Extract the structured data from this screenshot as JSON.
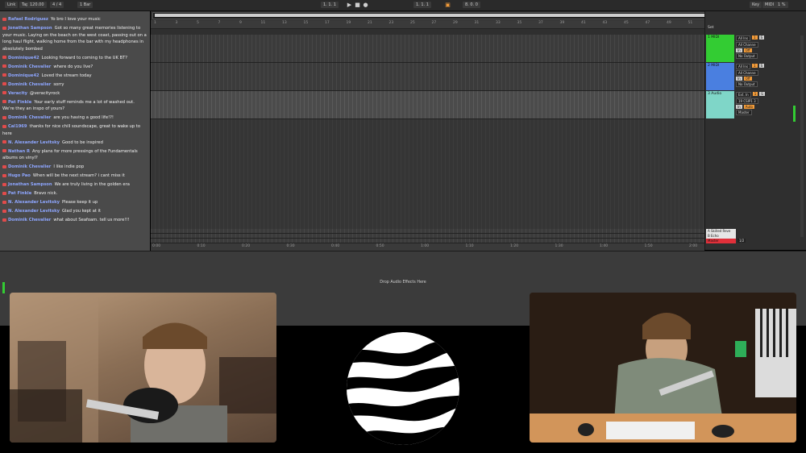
{
  "transport": {
    "link": "Link",
    "tap": "Tap",
    "bpm": "120.00",
    "sig": "4 / 4",
    "quant": "1 Bar",
    "position": "1. 1. 1",
    "loop_start": "1. 1. 1",
    "loop_len": "8. 0. 0",
    "key": "Key",
    "midi": "MIDI",
    "cpu": "1 %"
  },
  "chat": {
    "messages": [
      {
        "user": "Rafael Rodriguez",
        "text": "Yo bro I love your music",
        "color": "#8ea6ff"
      },
      {
        "user": "Jonathan Sampson",
        "text": "Got so many great memories listening to your music. Laying on the beach on the west coast, passing out on a long haul flight, walking home from the bar with my headphones in absolutely bombed",
        "color": "#8ea6ff"
      },
      {
        "user": "Dominique42",
        "text": "Looking forward to coming to the UK BT?",
        "color": "#8ea6ff"
      },
      {
        "user": "Dominik Chevalier",
        "text": "where do you live?",
        "color": "#8ea6ff"
      },
      {
        "user": "Dominique42",
        "text": "Loved the stream today",
        "color": "#8ea6ff"
      },
      {
        "user": "Dominik Chevalier",
        "text": "sorry",
        "color": "#8ea6ff"
      },
      {
        "user": "Veracity",
        "text": "@veracityrock",
        "color": "#8ea6ff"
      },
      {
        "user": "Pat Finkle",
        "text": "Your early stuff reminds me a lot of washed out. We're they an inspo of yours?",
        "color": "#8ea6ff"
      },
      {
        "user": "Dominik Chevalier",
        "text": "are you having a good life!?!",
        "color": "#8ea6ff"
      },
      {
        "user": "Cal1969",
        "text": "thanks for nice chill soundscape, great to wake up to here",
        "color": "#8ea6ff"
      },
      {
        "user": "N. Alexander Levitsky",
        "text": "Good to be inspired",
        "color": "#8ea6ff"
      },
      {
        "user": "Nathan R",
        "text": "Any plans for more pressings of the Fundamentals albums on vinyl?",
        "color": "#8ea6ff"
      },
      {
        "user": "Dominik Chevalier",
        "text": "I like indie pop",
        "color": "#8ea6ff"
      },
      {
        "user": "Hugo Pao",
        "text": "When will be the next stream? i cant miss it",
        "color": "#8ea6ff"
      },
      {
        "user": "Jonathan Sampson",
        "text": "We are truly living in the golden era",
        "color": "#8ea6ff"
      },
      {
        "user": "Pat Finkle",
        "text": "Bravo nick.",
        "color": "#8ea6ff"
      },
      {
        "user": "N. Alexander Levitsky",
        "text": "Please keep it up",
        "color": "#8ea6ff"
      },
      {
        "user": "N. Alexander Levitsky",
        "text": "Glad you kept at it",
        "color": "#8ea6ff"
      },
      {
        "user": "Dominik Chevalier",
        "text": "what about Seafoam. tell us more!!!",
        "color": "#8ea6ff"
      }
    ]
  },
  "arrangement": {
    "beats": [
      "1",
      "3",
      "5",
      "7",
      "9",
      "11",
      "13",
      "15",
      "17",
      "19",
      "21",
      "23",
      "25",
      "27",
      "29",
      "31",
      "33",
      "35",
      "37",
      "39",
      "41",
      "43",
      "45",
      "47",
      "49",
      "51"
    ],
    "times": [
      "0:00",
      "0:10",
      "0:20",
      "0:30",
      "0:40",
      "0:50",
      "1:00",
      "1:10",
      "1:20",
      "1:30",
      "1:40",
      "1:50",
      "2:00"
    ]
  },
  "tracks": [
    {
      "name": "1 MIDI",
      "color": "#33cc33",
      "in": "All Ins",
      "ch": "All Channe",
      "mon": "In",
      "auto": "Off",
      "out": "No Output"
    },
    {
      "name": "2 MIDI",
      "color": "#4a7fe0",
      "in": "All Ins",
      "ch": "All Channe",
      "mon": "In",
      "auto": "Off",
      "out": "No Output"
    },
    {
      "name": "3 Audio",
      "color": "#7fd6c8",
      "in": "Ext. In",
      "ch": "19 CSIP1 3",
      "mon": "In",
      "auto": "Auto",
      "out": "Master"
    }
  ],
  "returns": [
    {
      "name": "A Skilled Reve",
      "color": "#e6e6e6"
    },
    {
      "name": "B Echo",
      "color": "#e6e6e6"
    },
    {
      "name": "Master",
      "color": "#e0303a"
    }
  ],
  "mixer": {
    "set_label": "Set",
    "master_sel": "1/2"
  },
  "device": {
    "drop_text": "Drop Audio Effects Here"
  }
}
